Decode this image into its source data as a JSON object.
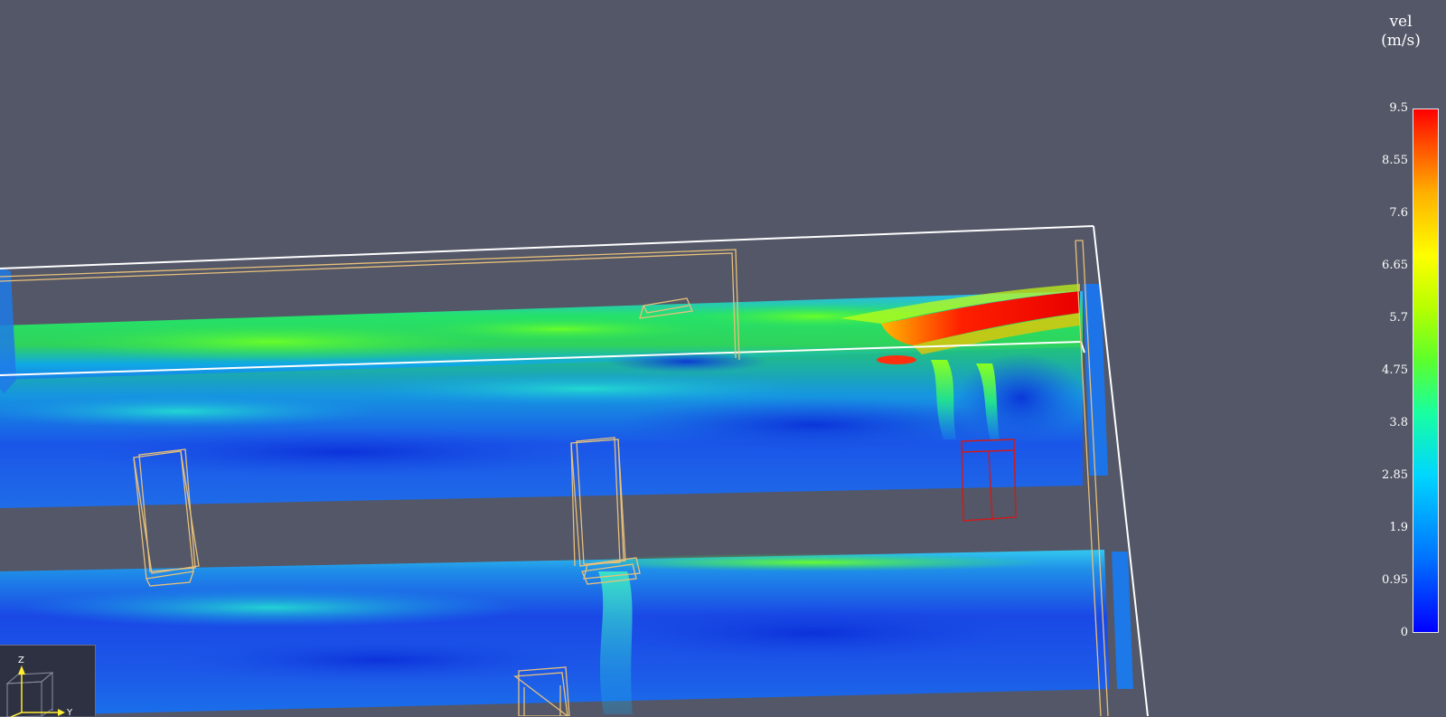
{
  "viewer": {
    "background": "#535767"
  },
  "colorbar": {
    "title_line1": "vel",
    "title_line2": "(m/s)",
    "ticks": [
      "9.5",
      "8.55",
      "7.6",
      "6.65",
      "5.7",
      "4.75",
      "3.8",
      "2.85",
      "1.9",
      "0.95",
      "0"
    ],
    "colors": {
      "min": "#0000ff",
      "mid": "#19ffa0",
      "max": "#ff0000"
    }
  },
  "orientation_axes": {
    "z_label": "Z",
    "y_label": "Y",
    "z_color": "#ffee33",
    "y_color": "#ffee33"
  },
  "outlines": {
    "domain_color": "#ffffff",
    "obstacle_color": "#e8c07a",
    "source_color": "#d11a1a"
  }
}
